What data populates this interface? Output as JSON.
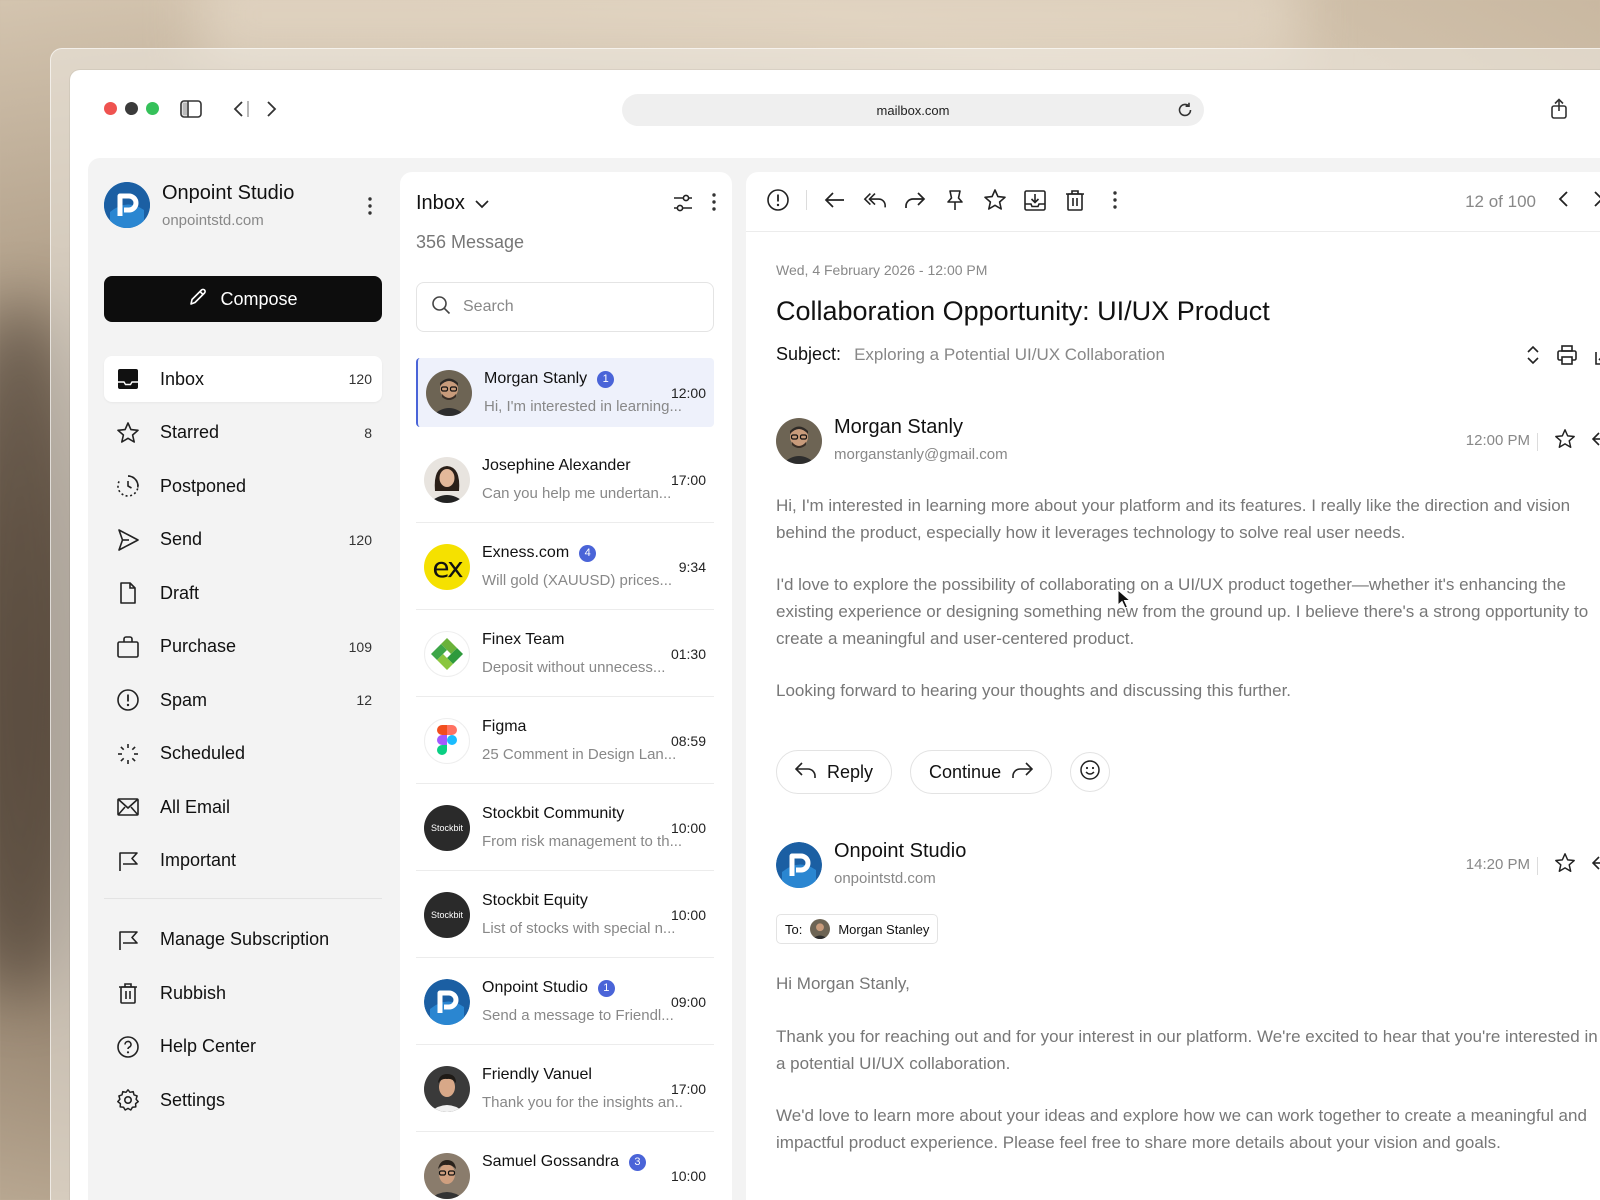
{
  "browser": {
    "url": "mailbox.com"
  },
  "brand": {
    "name": "Onpoint Studio",
    "domain": "onpointstd.com"
  },
  "sidebar": {
    "compose_label": "Compose",
    "items": [
      {
        "label": "Inbox",
        "count": "120",
        "icon": "inbox-icon"
      },
      {
        "label": "Starred",
        "count": "8",
        "icon": "star-icon"
      },
      {
        "label": "Postponed",
        "count": "",
        "icon": "clock-icon"
      },
      {
        "label": "Send",
        "count": "120",
        "icon": "send-icon"
      },
      {
        "label": "Draft",
        "count": "",
        "icon": "file-icon"
      },
      {
        "label": "Purchase",
        "count": "109",
        "icon": "bag-icon"
      },
      {
        "label": "Spam",
        "count": "12",
        "icon": "alert-icon"
      },
      {
        "label": "Scheduled",
        "count": "",
        "icon": "loader-icon"
      },
      {
        "label": "All Email",
        "count": "",
        "icon": "mail-icon"
      },
      {
        "label": "Important",
        "count": "",
        "icon": "flag-icon"
      }
    ],
    "secondary_items": [
      {
        "label": "Manage Subscription",
        "icon": "flag-icon"
      },
      {
        "label": "Rubbish",
        "icon": "trash-icon"
      },
      {
        "label": "Help Center",
        "icon": "help-icon"
      },
      {
        "label": "Settings",
        "icon": "gear-icon"
      }
    ]
  },
  "list": {
    "title": "Inbox",
    "message_count": "356 Message",
    "search_placeholder": "Search",
    "mails": [
      {
        "sender": "Morgan Stanly",
        "badge": "1",
        "preview": "Hi, I'm interested in learning...",
        "time": "12:00",
        "avatar": "morgan"
      },
      {
        "sender": "Josephine Alexander",
        "badge": "",
        "preview": "Can you help me undertan...",
        "time": "17:00",
        "avatar": "josephine"
      },
      {
        "sender": "Exness.com",
        "badge": "4",
        "preview": "Will gold (XAUUSD) prices...",
        "time": "9:34",
        "avatar": "exness"
      },
      {
        "sender": "Finex Team",
        "badge": "",
        "preview": "Deposit without unnecess...",
        "time": "01:30",
        "avatar": "finex"
      },
      {
        "sender": "Figma",
        "badge": "",
        "preview": "25 Comment in Design Lan...",
        "time": "08:59",
        "avatar": "figma"
      },
      {
        "sender": "Stockbit Community",
        "badge": "",
        "preview": "From risk management to th...",
        "time": "10:00",
        "avatar": "stockbit"
      },
      {
        "sender": "Stockbit Equity",
        "badge": "",
        "preview": "List of stocks with special n...",
        "time": "10:00",
        "avatar": "stockbit"
      },
      {
        "sender": "Onpoint Studio",
        "badge": "1",
        "preview": "Send a message to Friendl...",
        "time": "09:00",
        "avatar": "onpoint"
      },
      {
        "sender": "Friendly Vanuel",
        "badge": "",
        "preview": "Thank you for the insights an..",
        "time": "17:00",
        "avatar": "friendly"
      },
      {
        "sender": "Samuel Gossandra",
        "badge": "3",
        "preview": "",
        "time": "10:00",
        "avatar": "samuel"
      }
    ],
    "avatar_texts": {
      "exness": "ex",
      "stockbit": "Stockbit"
    }
  },
  "reader": {
    "pager": "12 of 100",
    "date": "Wed, 4 February 2026 - 12:00 PM",
    "title": "Collaboration Opportunity: UI/UX Product",
    "subject_label": "Subject:",
    "subject_value": "Exploring a Potential UI/UX Collaboration",
    "message1": {
      "from": "Morgan Stanly",
      "email": "morganstanly@gmail.com",
      "time": "12:00 PM",
      "p1": "Hi, I'm interested in learning more about your platform and its features. I really like the direction and vision behind the product, especially how it leverages technology to solve real user needs.",
      "p2": "I'd love to explore the possibility of collaborating on a UI/UX product together—whether it's enhancing the existing experience or designing something new from the ground up. I believe there's a strong opportunity to create a meaningful and user-centered product.",
      "p3": "Looking forward to hearing your thoughts and discussing this further."
    },
    "reply_label": "Reply",
    "continue_label": "Continue",
    "message2": {
      "from": "Onpoint Studio",
      "email": "onpointstd.com",
      "time": "14:20 PM",
      "to_label": "To:",
      "to_name": "Morgan Stanley",
      "greeting": "Hi Morgan Stanly,",
      "p1": "Thank you for reaching out and for your interest in our platform. We're excited to hear that you're interested in a potential UI/UX collaboration.",
      "p2": "We'd love to learn more about your ideas and explore how we can work together to create a meaningful and impactful product experience. Please feel free to share more details about your vision and goals."
    }
  },
  "colors": {
    "accent": "#4a64d8",
    "brand_blue": "#1f6fb6",
    "compose_bg": "#0d0d0d",
    "exness_yellow": "#f5e100"
  }
}
